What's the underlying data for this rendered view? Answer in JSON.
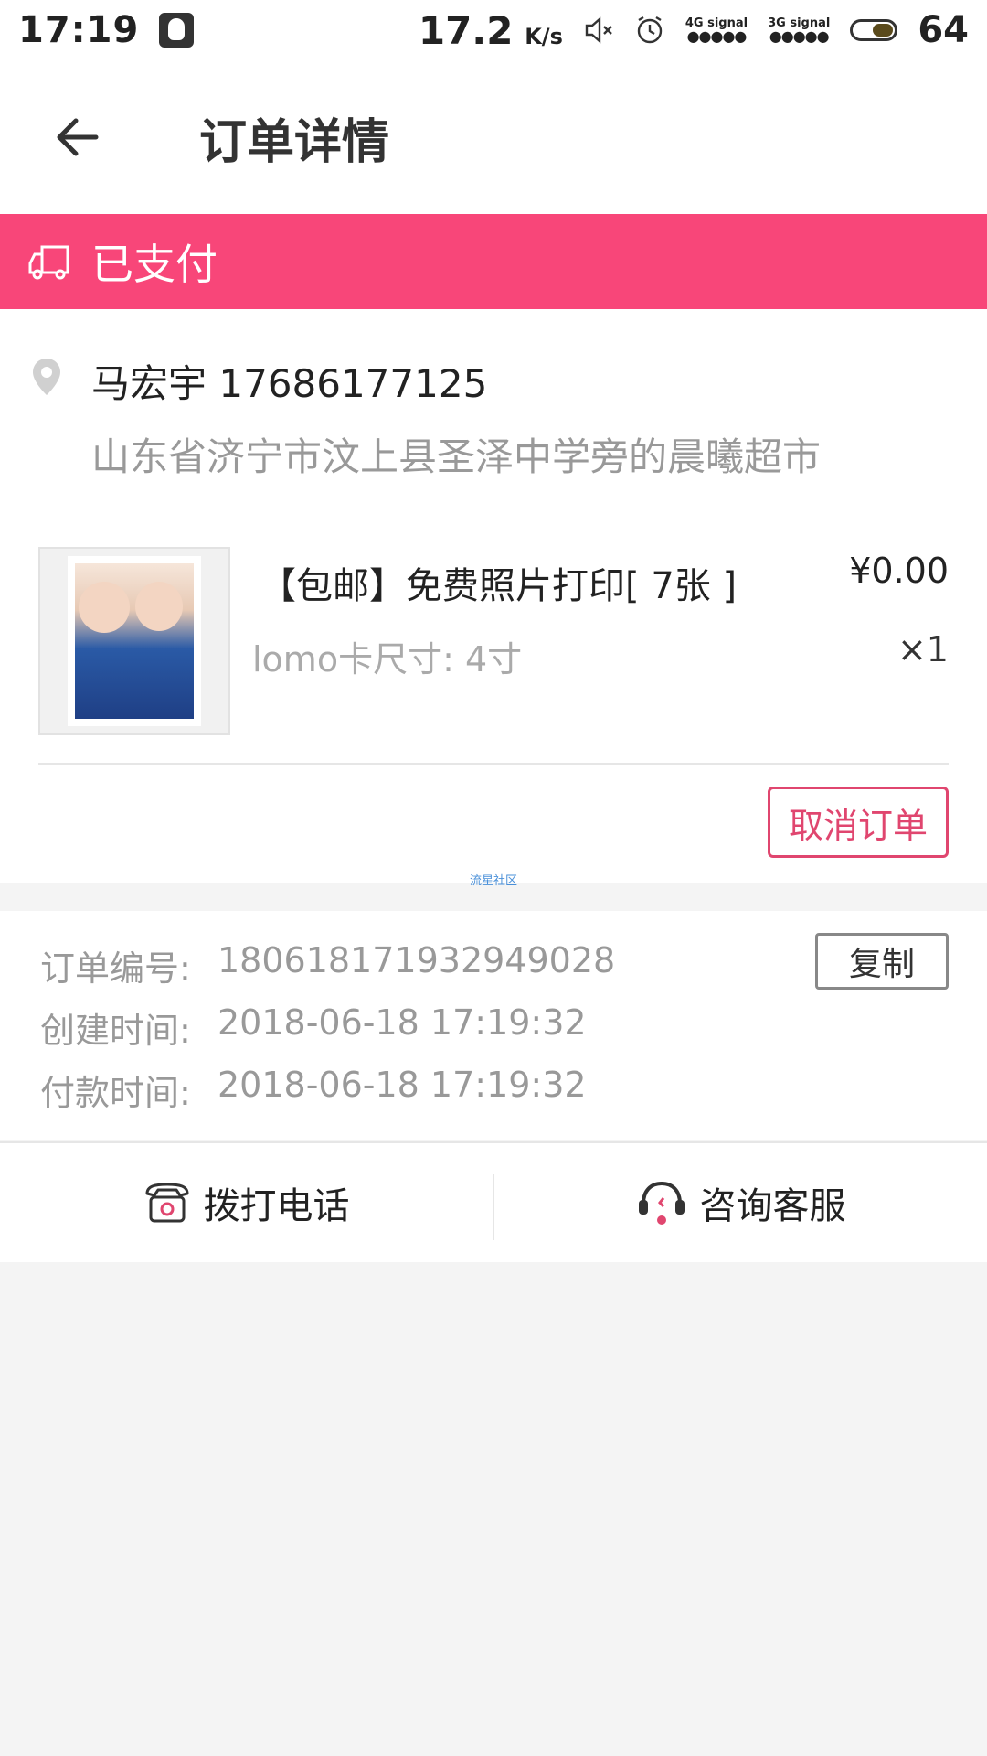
{
  "status_bar": {
    "time": "17:19",
    "speed": "17.2",
    "speed_unit": "K/s",
    "signal_4g": "4G signal",
    "signal_3g": "3G signal",
    "battery": "64"
  },
  "header": {
    "title": "订单详情"
  },
  "order_status": {
    "label": "已支付",
    "color": "#f84679"
  },
  "address": {
    "name_phone": "马宏宇 17686177125",
    "detail": "山东省济宁市汶上县圣泽中学旁的晨曦超市"
  },
  "product": {
    "title": "【包邮】免费照片打印[ 7张 ]",
    "spec": "lomo卡尺寸: 4寸",
    "price": "¥0.00",
    "qty": "×1"
  },
  "actions_top": {
    "cancel_label": "取消订单",
    "watermark": "流星社区"
  },
  "order_info": {
    "rows": [
      {
        "key": "订单编号:",
        "value": "180618171932949028"
      },
      {
        "key": "创建时间:",
        "value": "2018-06-18 17:19:32"
      },
      {
        "key": "付款时间:",
        "value": "2018-06-18 17:19:32"
      }
    ],
    "copy_label": "复制"
  },
  "bottom_actions": {
    "call_label": "拨打电话",
    "service_label": "咨询客服"
  },
  "colors": {
    "accent": "#f84679",
    "cancel": "#e0466f"
  },
  "icons": {
    "back": "arrow-left-icon",
    "status": "truck-icon",
    "pin": "location-pin-icon",
    "phone": "telephone-icon",
    "service": "headset-icon"
  }
}
